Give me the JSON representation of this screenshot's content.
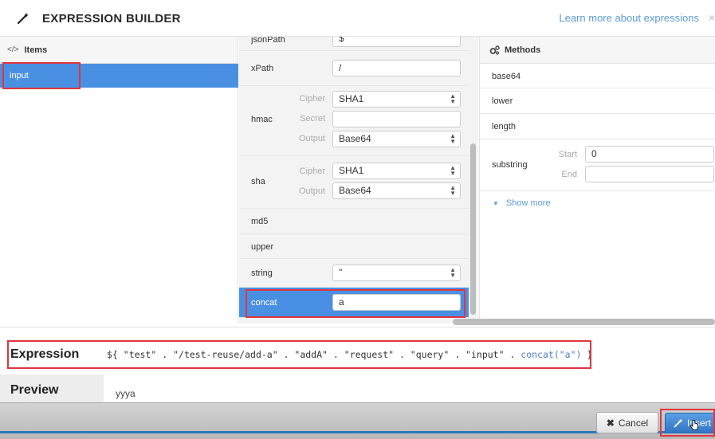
{
  "header": {
    "title": "EXPRESSION BUILDER",
    "learn_link": "Learn more about expressions",
    "close_glyph": "×",
    "icon": "wand-icon"
  },
  "items_panel": {
    "title": "Items",
    "icon": "code-icon",
    "icon_glyph": "</>",
    "items": [
      {
        "label": "input",
        "selected": true
      }
    ]
  },
  "functions": {
    "jsonpath": {
      "label": "jsonPath",
      "value": "$"
    },
    "xpath": {
      "label": "xPath",
      "value": "/"
    },
    "hmac": {
      "label": "hmac",
      "cipher_label": "Cipher",
      "cipher_value": "SHA1",
      "secret_label": "Secret",
      "secret_value": "",
      "output_label": "Output",
      "output_value": "Base64"
    },
    "sha": {
      "label": "sha",
      "cipher_label": "Cipher",
      "cipher_value": "SHA1",
      "output_label": "Output",
      "output_value": "Base64"
    },
    "md5": {
      "label": "md5"
    },
    "upper": {
      "label": "upper"
    },
    "string": {
      "label": "string",
      "value": "\""
    },
    "concat": {
      "label": "concat",
      "value": "a",
      "selected": true
    }
  },
  "methods_panel": {
    "title": "Methods",
    "icon": "gears-icon",
    "base64": "base64",
    "lower": "lower",
    "length": "length",
    "substring": {
      "label": "substring",
      "start_label": "Start",
      "start_value": "0",
      "end_label": "End",
      "end_value": ""
    },
    "show_more": "Show more"
  },
  "expression": {
    "label": "Expression",
    "prefix": "${ ",
    "path": "\"test\" . \"/test-reuse/add-a\" . \"addA\" . \"request\" . \"query\" . \"input\" . ",
    "call": "concat(\"a\")",
    "suffix": " }"
  },
  "preview": {
    "label": "Preview",
    "value": "yyya"
  },
  "footer": {
    "cancel_label": "Cancel",
    "cancel_glyph": "✖",
    "insert_label": "Insert"
  },
  "colors": {
    "accent": "#4a90e2",
    "highlight": "#e0353f",
    "link": "#5b9bd5"
  }
}
